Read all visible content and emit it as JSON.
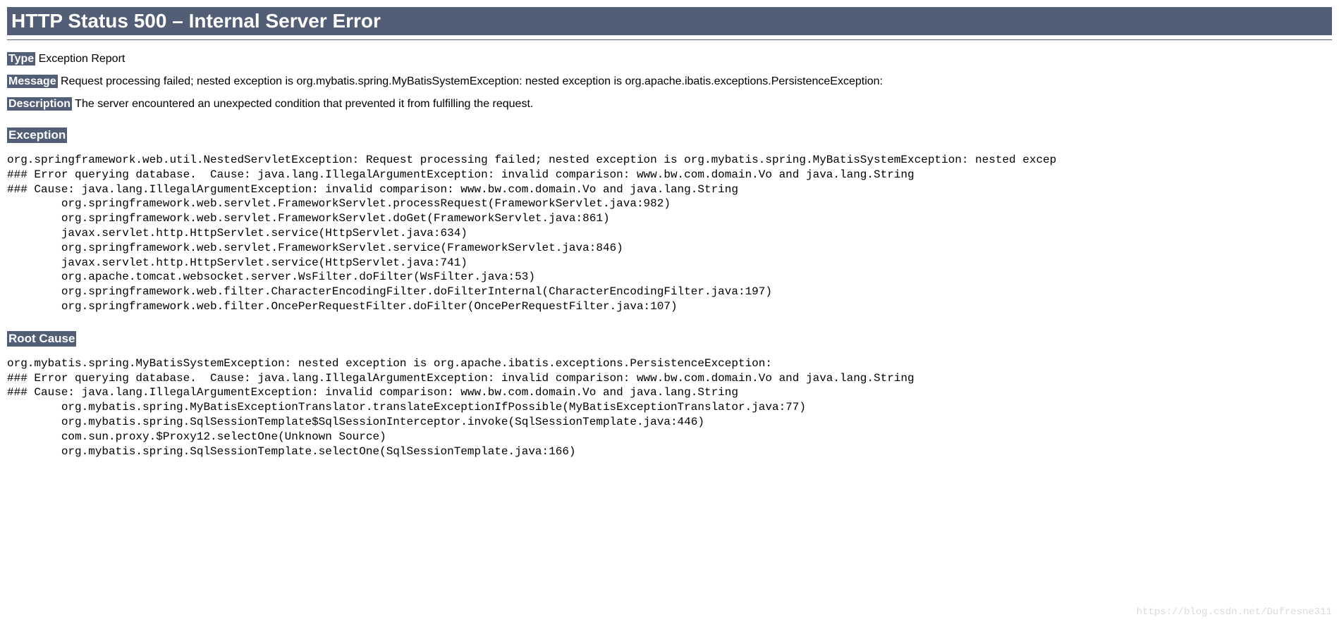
{
  "title": "HTTP Status 500 – Internal Server Error",
  "rows": {
    "type": {
      "label": "Type",
      "value": " Exception Report"
    },
    "message": {
      "label": "Message",
      "value": " Request processing failed; nested exception is org.mybatis.spring.MyBatisSystemException: nested exception is org.apache.ibatis.exceptions.PersistenceException:"
    },
    "description": {
      "label": "Description",
      "value": " The server encountered an unexpected condition that prevented it from fulfilling the request."
    }
  },
  "exception": {
    "label": "Exception",
    "trace": "org.springframework.web.util.NestedServletException: Request processing failed; nested exception is org.mybatis.spring.MyBatisSystemException: nested excep\n### Error querying database.  Cause: java.lang.IllegalArgumentException: invalid comparison: www.bw.com.domain.Vo and java.lang.String\n### Cause: java.lang.IllegalArgumentException: invalid comparison: www.bw.com.domain.Vo and java.lang.String\n        org.springframework.web.servlet.FrameworkServlet.processRequest(FrameworkServlet.java:982)\n        org.springframework.web.servlet.FrameworkServlet.doGet(FrameworkServlet.java:861)\n        javax.servlet.http.HttpServlet.service(HttpServlet.java:634)\n        org.springframework.web.servlet.FrameworkServlet.service(FrameworkServlet.java:846)\n        javax.servlet.http.HttpServlet.service(HttpServlet.java:741)\n        org.apache.tomcat.websocket.server.WsFilter.doFilter(WsFilter.java:53)\n        org.springframework.web.filter.CharacterEncodingFilter.doFilterInternal(CharacterEncodingFilter.java:197)\n        org.springframework.web.filter.OncePerRequestFilter.doFilter(OncePerRequestFilter.java:107)"
  },
  "rootCause": {
    "label": "Root Cause",
    "trace": "org.mybatis.spring.MyBatisSystemException: nested exception is org.apache.ibatis.exceptions.PersistenceException:\n### Error querying database.  Cause: java.lang.IllegalArgumentException: invalid comparison: www.bw.com.domain.Vo and java.lang.String\n### Cause: java.lang.IllegalArgumentException: invalid comparison: www.bw.com.domain.Vo and java.lang.String\n        org.mybatis.spring.MyBatisExceptionTranslator.translateExceptionIfPossible(MyBatisExceptionTranslator.java:77)\n        org.mybatis.spring.SqlSessionTemplate$SqlSessionInterceptor.invoke(SqlSessionTemplate.java:446)\n        com.sun.proxy.$Proxy12.selectOne(Unknown Source)\n        org.mybatis.spring.SqlSessionTemplate.selectOne(SqlSessionTemplate.java:166)"
  },
  "watermark": "https://blog.csdn.net/Dufresne311"
}
